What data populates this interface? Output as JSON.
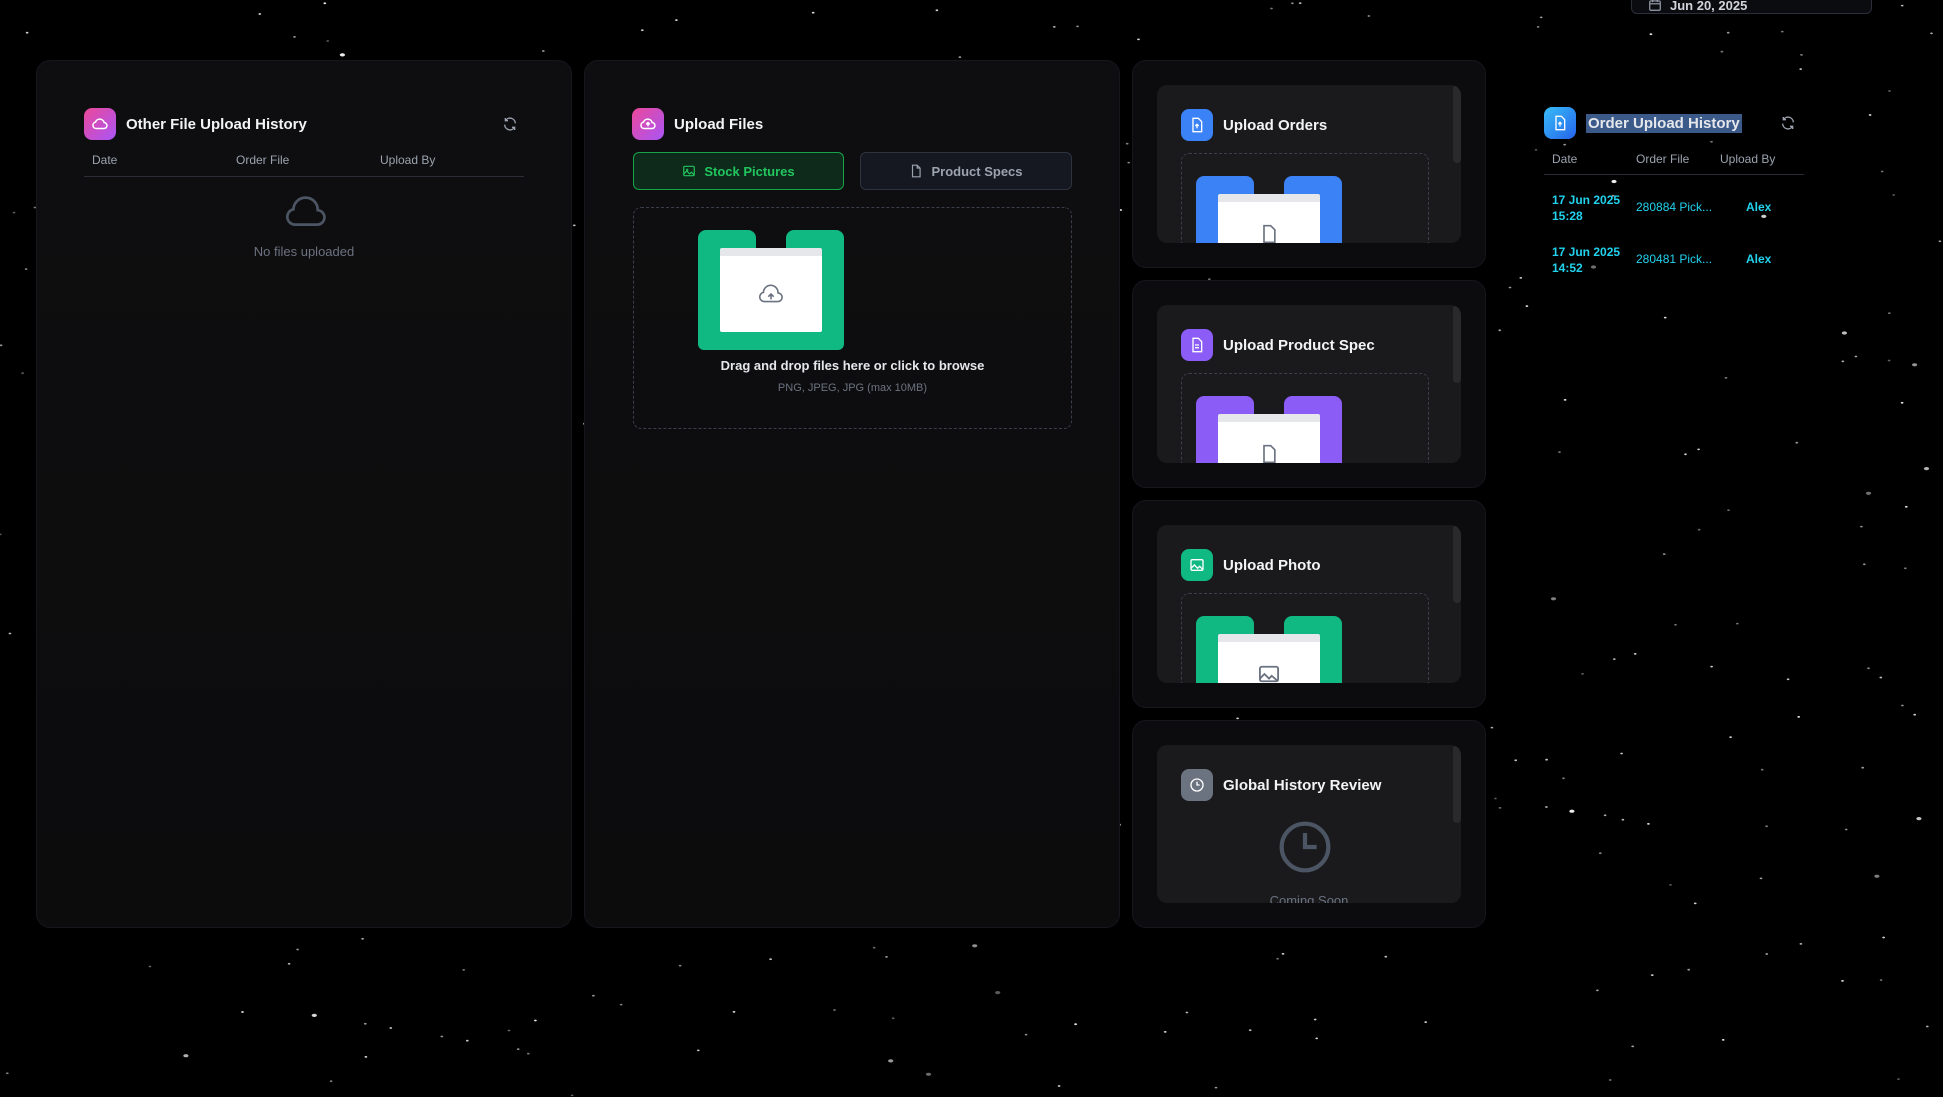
{
  "top_bar": {
    "date_label": "Jun 20, 2025"
  },
  "left_panel": {
    "title": "Other File Upload History",
    "columns": [
      "Date",
      "Order File",
      "Upload By"
    ],
    "empty_message": "No files uploaded"
  },
  "mid_panel": {
    "title": "Upload Files",
    "tabs": [
      {
        "label": "Stock Pictures",
        "active": true
      },
      {
        "label": "Product Specs",
        "active": false
      }
    ],
    "dropzone": {
      "title": "Drag and drop files here or click to browse",
      "subtitle": "PNG, JPEG, JPG (max 10MB)"
    }
  },
  "cards": [
    {
      "title": "Upload Orders",
      "color": "#3b82f6"
    },
    {
      "title": "Upload Product Spec",
      "color": "#8b5cf6"
    },
    {
      "title": "Upload Photo",
      "color": "#10b981"
    },
    {
      "title": "Global History Review",
      "color": "#6b7280",
      "status": "Coming Soon"
    }
  ],
  "order_history": {
    "title": "Order Upload History",
    "columns": [
      "Date",
      "Order File",
      "Upload By"
    ],
    "rows": [
      {
        "date_line1": "17 Jun 2025",
        "date_line2": "15:28",
        "file": "280884 Pick...",
        "by": "Alex"
      },
      {
        "date_line1": "17 Jun 2025",
        "date_line2": "14:52",
        "file": "280481 Pick...",
        "by": "Alex"
      }
    ]
  },
  "colors": {
    "accent_green": "#22c55e",
    "accent_cyan": "#22d3ee",
    "pink_badge": "#d946ef"
  }
}
